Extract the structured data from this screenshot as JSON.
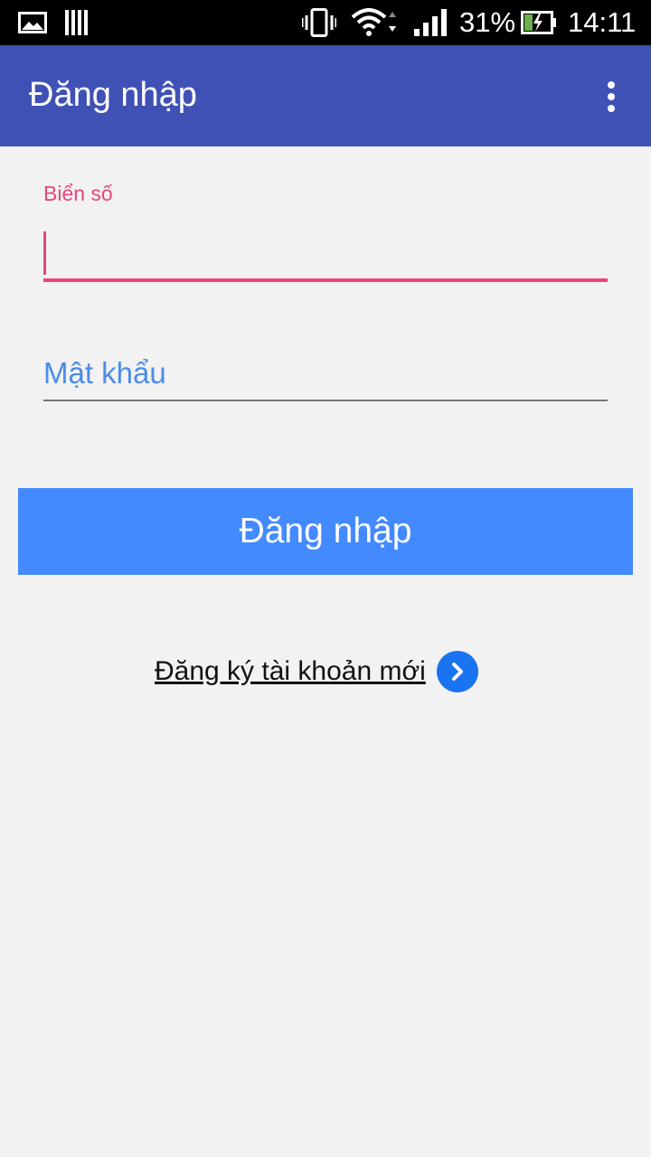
{
  "status_bar": {
    "battery_percent": "31%",
    "time": "14:11",
    "icons": [
      "picture-icon",
      "barcode-icon",
      "vibrate-icon",
      "wifi-icon",
      "signal-icon",
      "battery-charging-icon"
    ]
  },
  "app_bar": {
    "title": "Đăng nhập",
    "menu_icon": "overflow-menu-icon"
  },
  "form": {
    "plate_field": {
      "label": "Biển số",
      "value": ""
    },
    "password_field": {
      "placeholder": "Mật khẩu",
      "value": ""
    },
    "submit_label": "Đăng nhập"
  },
  "register": {
    "label": "Đăng ký tài khoản mới",
    "icon": "chevron-right-circle-icon"
  },
  "colors": {
    "app_bar": "#3f51b5",
    "accent": "#e8457d",
    "button": "#448aff",
    "placeholder": "#4a8de8",
    "background": "#f2f2f2"
  }
}
